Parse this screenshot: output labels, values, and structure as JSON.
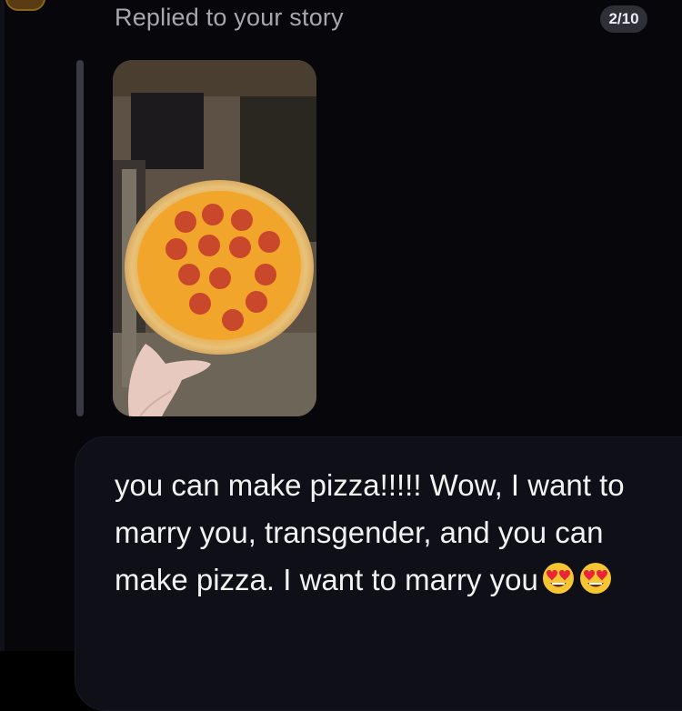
{
  "header": {
    "reply_label": "Replied to your story",
    "counter": "2/10"
  },
  "story": {
    "image": "story-photo-pepperoni-pizza"
  },
  "message": {
    "text": "you can make pizza!!!!! Wow, I want to marry you, transgender, and you can make pizza. I want to marry you",
    "emojis": [
      "heart-eyes-emoji",
      "heart-eyes-emoji"
    ]
  },
  "colors": {
    "background": "#06060b",
    "bubble": "#0f0f18",
    "label_text": "#a7a7ad",
    "message_text": "#f2f2f2",
    "badge": "#2f2f38"
  }
}
